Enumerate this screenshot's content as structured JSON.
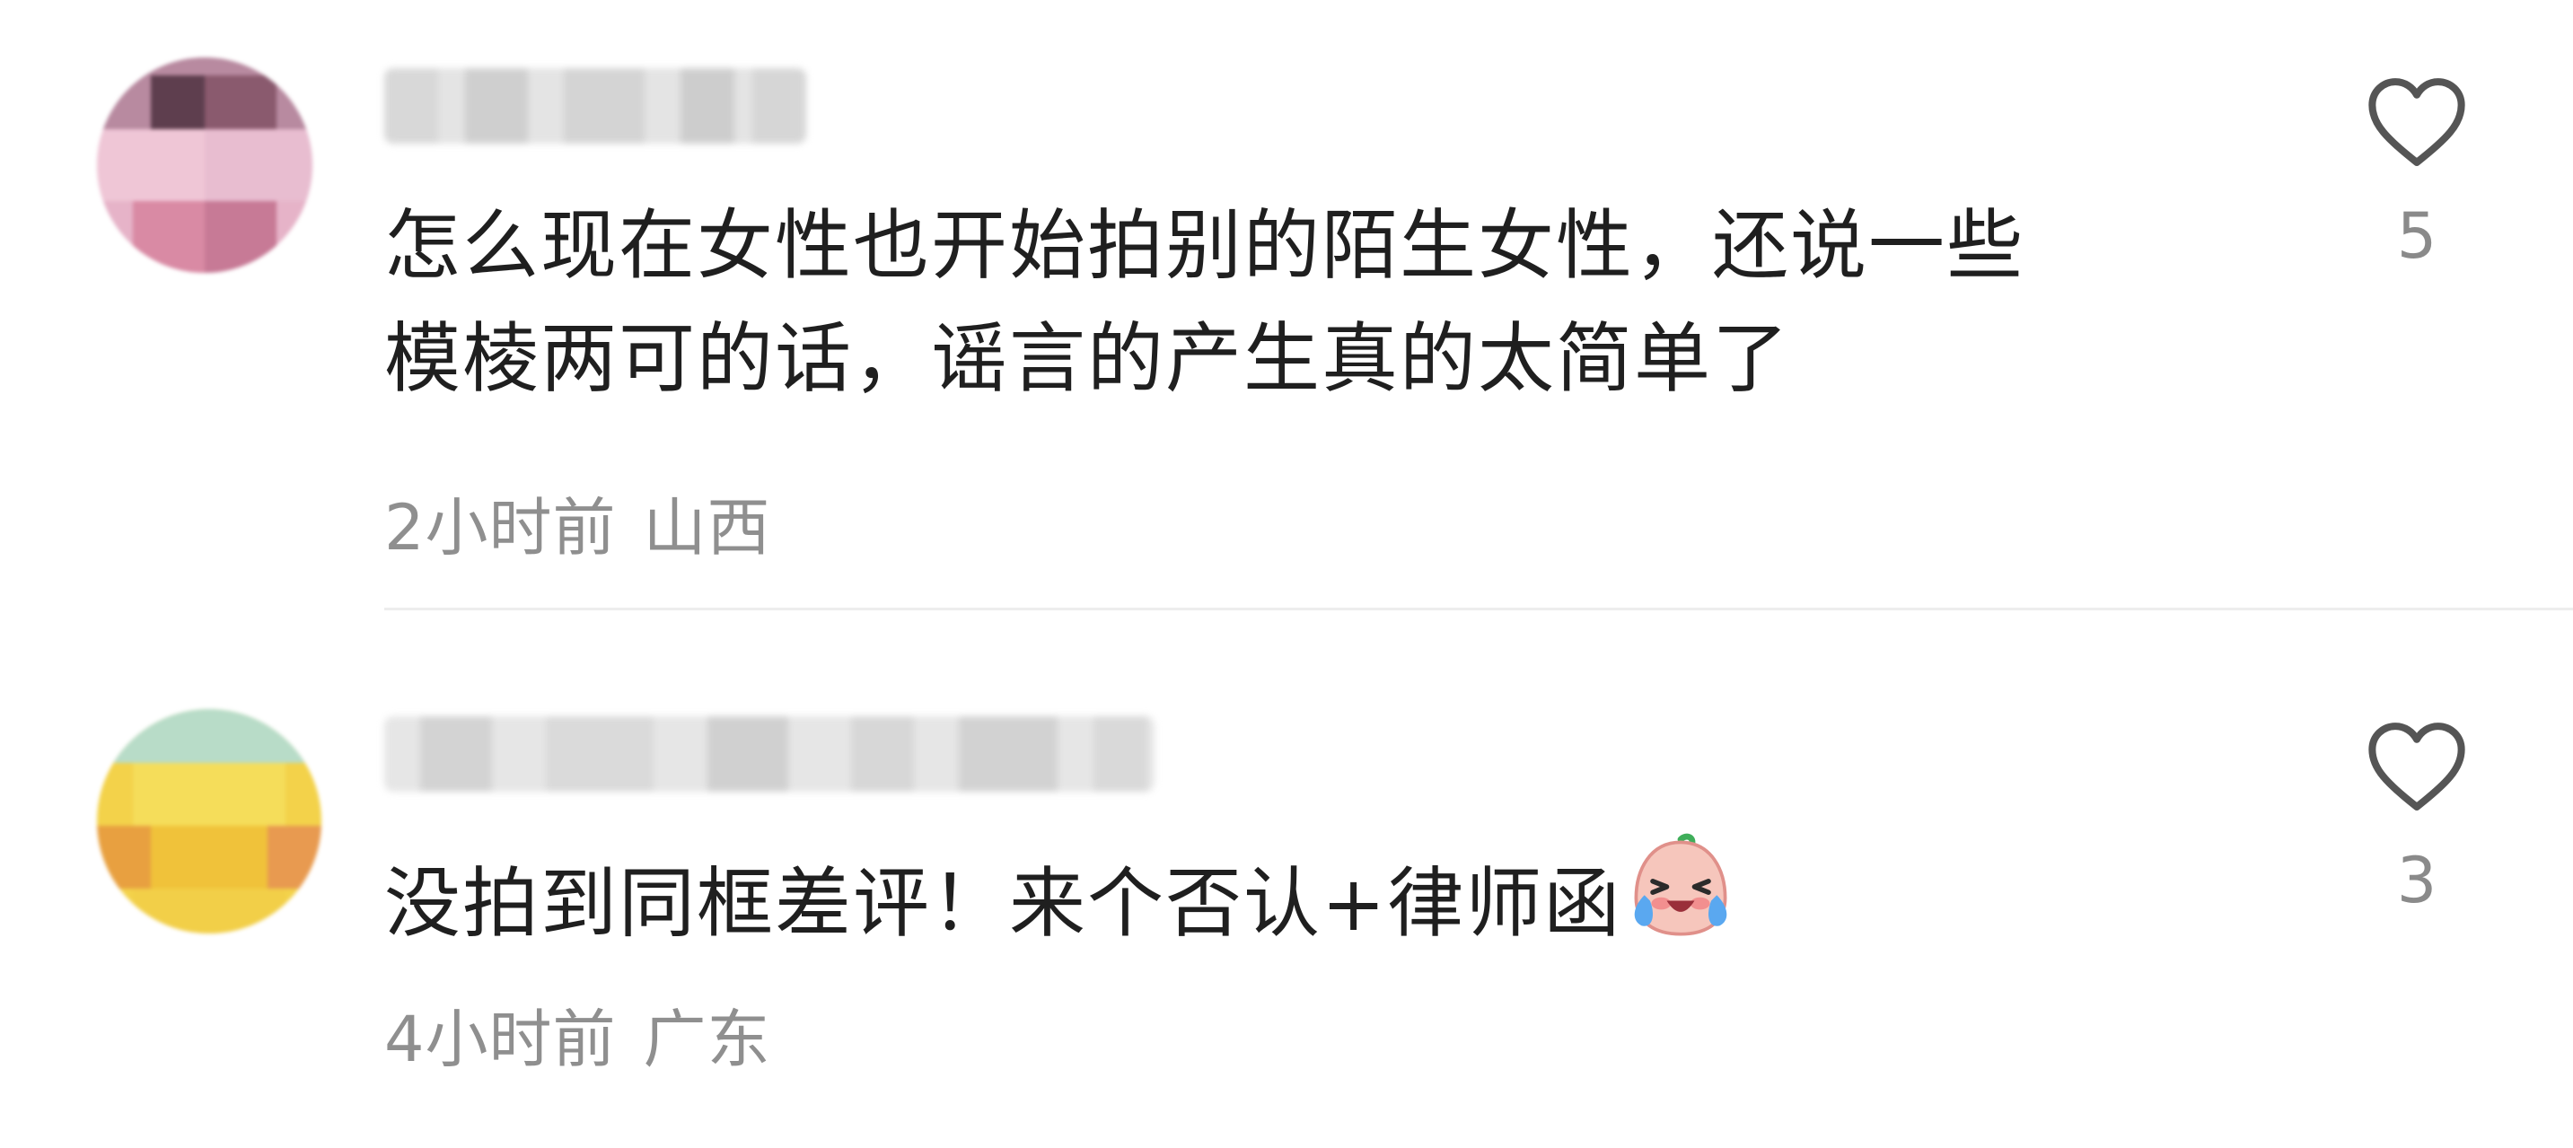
{
  "comments": [
    {
      "username": "",
      "text_line1": "怎么现在女性也开始拍别的陌生女性，还说一些",
      "text_line2": "模棱两可的话，谣言的产生真的太简单了",
      "time": "2小时前",
      "location": "山西",
      "likes": "5",
      "avatar_colors": [
        "#d9a0b8",
        "#c77a96",
        "#efc6d6",
        "#8a5a6e"
      ]
    },
    {
      "username": "",
      "text": "没拍到同框差评！来个否认+律师函",
      "emoji": "laughing-crying-emoji",
      "time": "4小时前",
      "location": "广东",
      "likes": "3",
      "avatar_colors": [
        "#f5d84a",
        "#f0c23a",
        "#e8a040",
        "#b8dcc8"
      ]
    }
  ],
  "colors": {
    "text": "#1f1f1f",
    "meta": "#8f8f8f",
    "divider": "#ededed",
    "heart_outline": "#555555"
  }
}
